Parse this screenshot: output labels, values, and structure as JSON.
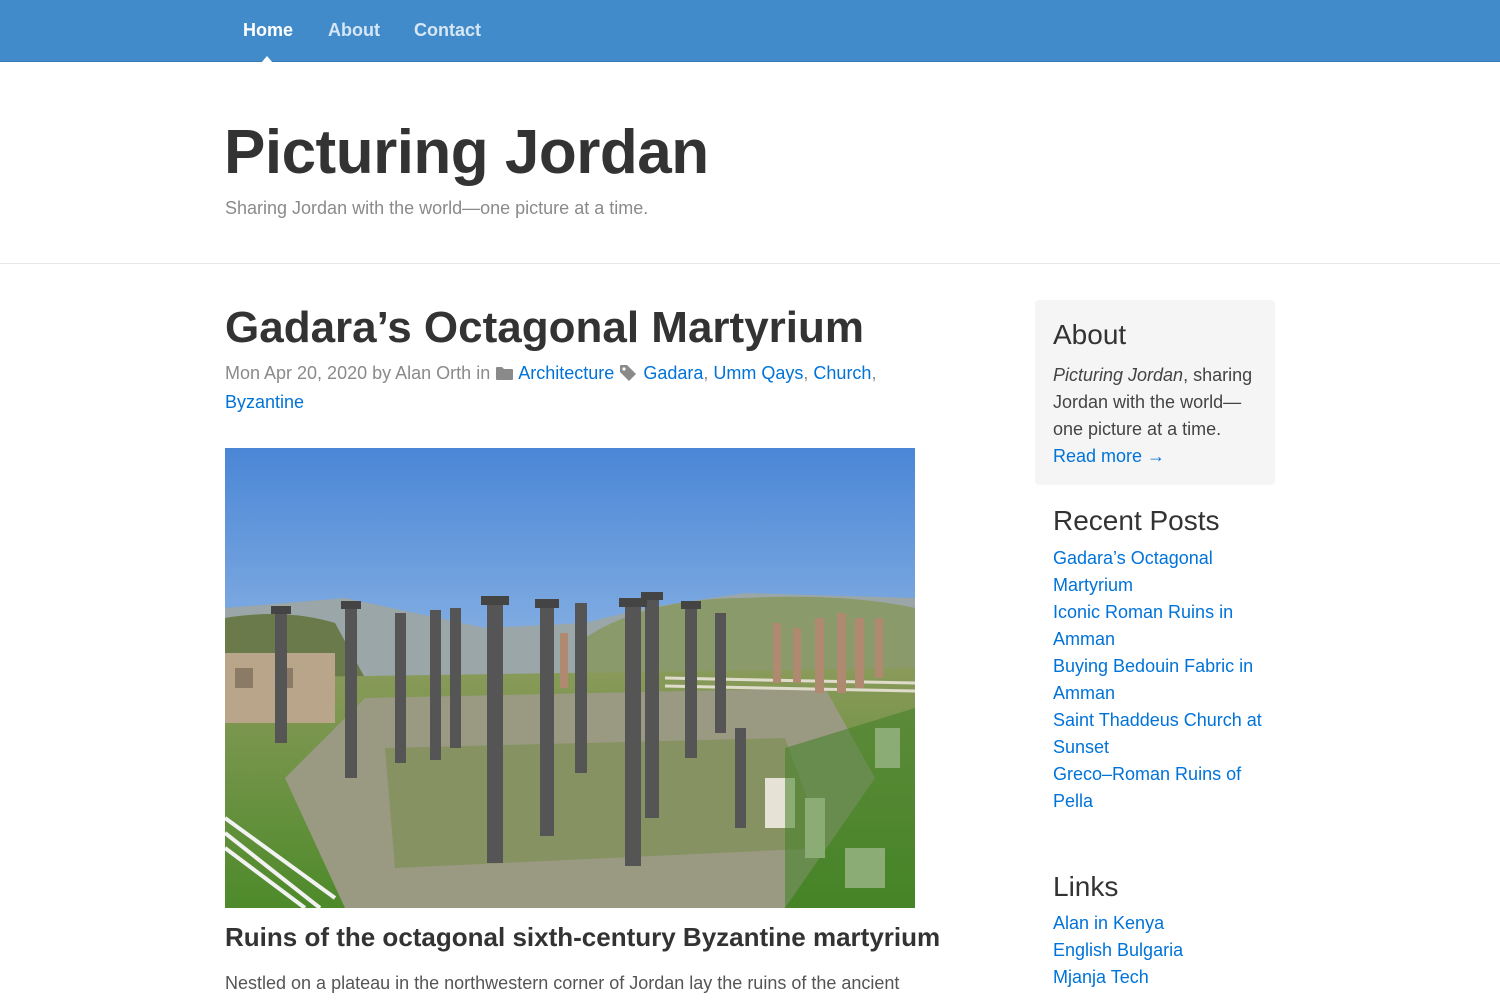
{
  "nav": {
    "items": [
      {
        "label": "Home"
      },
      {
        "label": "About"
      },
      {
        "label": "Contact"
      }
    ]
  },
  "header": {
    "title": "Picturing Jordan",
    "tagline": "Sharing Jordan with the world—one picture at a time."
  },
  "post": {
    "title": "Gadara’s Octagonal Martyrium",
    "meta": {
      "date": "Mon Apr 20, 2020",
      "by": "by",
      "author": "Alan Orth",
      "in": "in",
      "category": "Architecture",
      "tags": [
        "Gadara",
        "Umm Qays",
        "Church",
        "Byzantine"
      ]
    },
    "image_alt": "Ruins of the octagonal sixth-century Byzantine martyrium",
    "caption": "Ruins of the octagonal sixth-century Byzantine martyrium",
    "intro": "Nestled on a plateau in the northwestern corner of Jordan lay the ruins of the ancient"
  },
  "sidebar": {
    "about": {
      "heading": "About",
      "emph": "Picturing Jordan",
      "text": ", sharing Jordan with the world—one picture at a time.",
      "read_more": "Read more →"
    },
    "recent": {
      "heading": "Recent Posts",
      "items": [
        "Gadara’s Octagonal Martyrium",
        "Iconic Roman Ruins in Amman",
        "Buying Bedouin Fabric in Amman",
        "Saint Thaddeus Church at Sunset",
        "Greco–Roman Ruins of Pella"
      ]
    },
    "links": {
      "heading": "Links",
      "items": [
        "Alan in Kenya",
        "English Bulgaria",
        "Mjanja Tech"
      ]
    }
  },
  "colors": {
    "navbar": "#428bca",
    "link": "#0073d9",
    "about_bg": "#f5f5f5"
  }
}
